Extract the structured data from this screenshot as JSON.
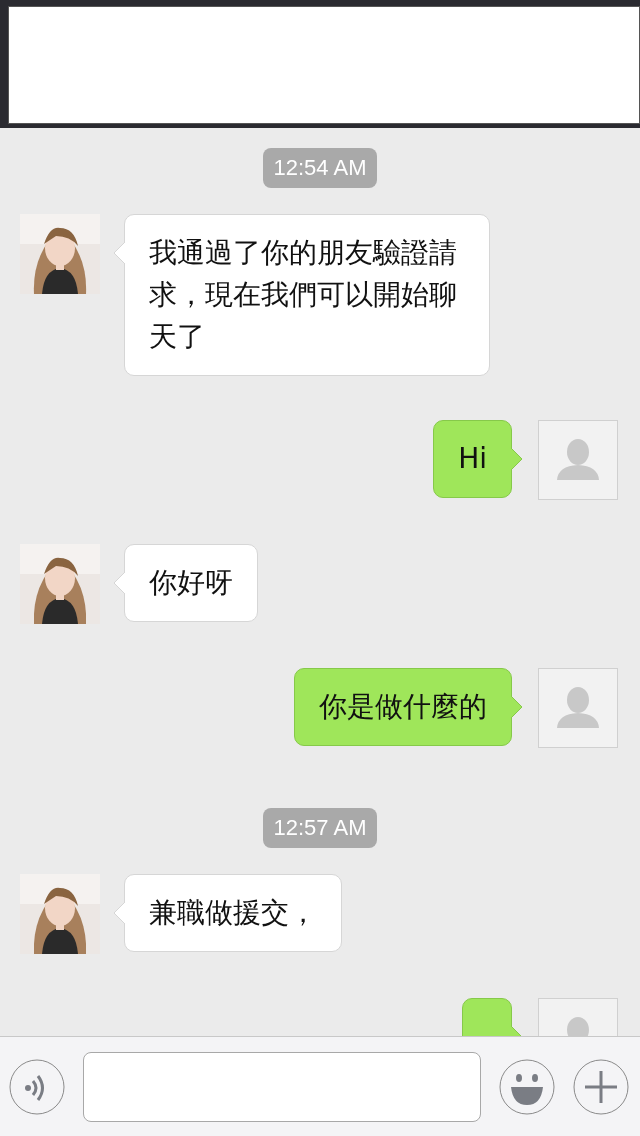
{
  "chat": [
    {
      "kind": "time",
      "text": "12:54 AM"
    },
    {
      "kind": "incoming",
      "text": "我通過了你的朋友驗證請求，現在我們可以開始聊天了"
    },
    {
      "kind": "outgoing",
      "text": "Hi"
    },
    {
      "kind": "incoming",
      "text": "你好呀"
    },
    {
      "kind": "outgoing",
      "text": "你是做什麼的"
    },
    {
      "kind": "time",
      "text": "12:57 AM"
    },
    {
      "kind": "incoming",
      "text": "兼職做援交，"
    },
    {
      "kind": "outgoing"
    }
  ]
}
